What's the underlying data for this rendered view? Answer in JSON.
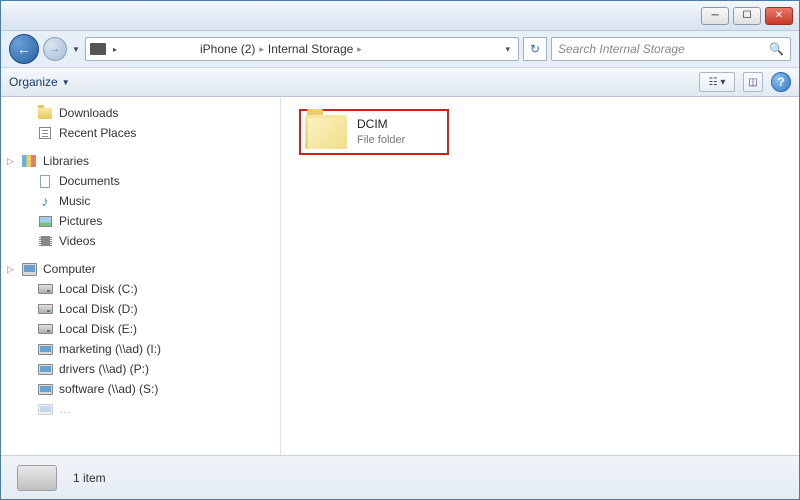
{
  "breadcrumb": {
    "seg1": "iPhone (2)",
    "seg2": "Internal Storage"
  },
  "search": {
    "placeholder": "Search Internal Storage"
  },
  "toolbar": {
    "organize": "Organize"
  },
  "nav": {
    "downloads": "Downloads",
    "recent": "Recent Places",
    "libraries": "Libraries",
    "documents": "Documents",
    "music": "Music",
    "pictures": "Pictures",
    "videos": "Videos",
    "computer": "Computer",
    "diskC": "Local Disk (C:)",
    "diskD": "Local Disk (D:)",
    "diskE": "Local Disk (E:)",
    "netI": "marketing (\\\\ad) (I:)",
    "netP": "drivers (\\\\ad) (P:)",
    "netS": "software (\\\\ad) (S:)"
  },
  "content": {
    "folder_name": "DCIM",
    "folder_type": "File folder"
  },
  "status": {
    "count": "1 item"
  }
}
